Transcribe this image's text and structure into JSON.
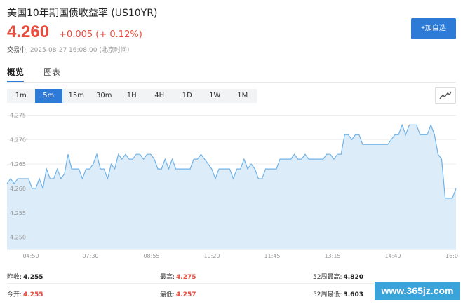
{
  "header": {
    "title": "美国10年期国债收益率 (US10YR)",
    "price": "4.260",
    "change": "+0.005 (+ 0.12%)",
    "status": "交易中,",
    "time": "2025-08-27 16:08:00 (北京时间)",
    "add_label": "+加自选"
  },
  "tabs": [
    {
      "label": "概览",
      "active": true
    },
    {
      "label": "图表",
      "active": false
    }
  ],
  "periods": [
    {
      "label": "1m",
      "active": false
    },
    {
      "label": "5m",
      "active": true
    },
    {
      "label": "15m",
      "active": false
    },
    {
      "label": "30m",
      "active": false
    },
    {
      "label": "1H",
      "active": false
    },
    {
      "label": "4H",
      "active": false
    },
    {
      "label": "1D",
      "active": false
    },
    {
      "label": "1W",
      "active": false
    },
    {
      "label": "1M",
      "active": false
    }
  ],
  "chart_data": {
    "type": "area",
    "x_ticks": [
      "04:50",
      "07:30",
      "08:55",
      "10:20",
      "11:45",
      "13:15",
      "14:40",
      "16:0"
    ],
    "y_ticks": [
      "4.275",
      "4.270",
      "4.265",
      "4.260",
      "4.255",
      "4.250"
    ],
    "ylim": [
      4.2475,
      4.2765
    ],
    "values": [
      4.261,
      4.262,
      4.261,
      4.262,
      4.262,
      4.262,
      4.262,
      4.26,
      4.26,
      4.262,
      4.26,
      4.264,
      4.262,
      4.262,
      4.264,
      4.262,
      4.263,
      4.267,
      4.264,
      4.264,
      4.264,
      4.262,
      4.264,
      4.264,
      4.265,
      4.267,
      4.264,
      4.264,
      4.262,
      4.265,
      4.264,
      4.267,
      4.266,
      4.267,
      4.266,
      4.266,
      4.267,
      4.267,
      4.266,
      4.267,
      4.267,
      4.266,
      4.264,
      4.264,
      4.266,
      4.264,
      4.266,
      4.264,
      4.264,
      4.264,
      4.264,
      4.264,
      4.266,
      4.266,
      4.267,
      4.266,
      4.265,
      4.264,
      4.262,
      4.264,
      4.264,
      4.264,
      4.264,
      4.262,
      4.264,
      4.264,
      4.266,
      4.264,
      4.265,
      4.264,
      4.262,
      4.262,
      4.264,
      4.264,
      4.264,
      4.264,
      4.266,
      4.266,
      4.266,
      4.266,
      4.267,
      4.266,
      4.266,
      4.267,
      4.266,
      4.266,
      4.266,
      4.266,
      4.266,
      4.267,
      4.267,
      4.266,
      4.267,
      4.267,
      4.271,
      4.271,
      4.27,
      4.271,
      4.271,
      4.269,
      4.269,
      4.269,
      4.269,
      4.269,
      4.269,
      4.269,
      4.269,
      4.27,
      4.271,
      4.271,
      4.273,
      4.271,
      4.273,
      4.273,
      4.273,
      4.271,
      4.271,
      4.271,
      4.273,
      4.271,
      4.267,
      4.266,
      4.258,
      4.258,
      4.258,
      4.26
    ],
    "line_color": "#6fb2e8",
    "fill_color": "#ddecf9"
  },
  "stats": [
    {
      "label": "昨收:",
      "value": "4.255",
      "red": false
    },
    {
      "label": "最高:",
      "value": "4.275",
      "red": true
    },
    {
      "label": "52周最高:",
      "value": "4.820",
      "red": false
    },
    {
      "label": "今开:",
      "value": "4.255",
      "red": true
    },
    {
      "label": "最低:",
      "value": "4.257",
      "red": true
    },
    {
      "label": "52周最低:",
      "value": "3.603",
      "red": false
    }
  ],
  "watermark": "www.365jz.com"
}
